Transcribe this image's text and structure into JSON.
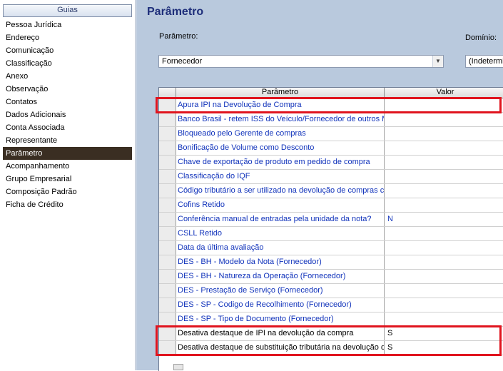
{
  "sidebar": {
    "header": "Guias",
    "items": [
      {
        "label": "Pessoa Jurídica",
        "selected": false
      },
      {
        "label": "Endereço",
        "selected": false
      },
      {
        "label": "Comunicação",
        "selected": false
      },
      {
        "label": "Classificação",
        "selected": false
      },
      {
        "label": "Anexo",
        "selected": false
      },
      {
        "label": "Observação",
        "selected": false
      },
      {
        "label": "Contatos",
        "selected": false
      },
      {
        "label": "Dados Adicionais",
        "selected": false
      },
      {
        "label": "Conta Associada",
        "selected": false
      },
      {
        "label": "Representante",
        "selected": false
      },
      {
        "label": "Parâmetro",
        "selected": true
      },
      {
        "label": "Acompanhamento",
        "selected": false
      },
      {
        "label": "Grupo Empresarial",
        "selected": false
      },
      {
        "label": "Composição Padrão",
        "selected": false
      },
      {
        "label": "Ficha de Crédito",
        "selected": false
      }
    ]
  },
  "main": {
    "title": "Parâmetro",
    "parametro_label": "Parâmetro:",
    "parametro_value": "Fornecedor",
    "dominio_label": "Domínio:",
    "dominio_value": "(Indetermin"
  },
  "grid": {
    "columns": [
      "Parâmetro",
      "Valor"
    ],
    "rows": [
      {
        "param": "Apura IPI na Devolução de Compra",
        "value": "",
        "highlight": true
      },
      {
        "param": "Banco Brasil - retem ISS do Veículo/Fornecedor de outros M",
        "value": ""
      },
      {
        "param": "Bloqueado pelo Gerente de compras",
        "value": ""
      },
      {
        "param": "Bonificação de Volume como Desconto",
        "value": ""
      },
      {
        "param": "Chave de exportação de produto em pedido de compra",
        "value": ""
      },
      {
        "param": "Classificação do IQF",
        "value": ""
      },
      {
        "param": "Código tributário a ser utilizado na devolução de compras co",
        "value": ""
      },
      {
        "param": "Cofins Retido",
        "value": ""
      },
      {
        "param": "Conferência manual de entradas pela unidade da nota?",
        "value": "N"
      },
      {
        "param": "CSLL Retido",
        "value": ""
      },
      {
        "param": "Data da última avaliação",
        "value": ""
      },
      {
        "param": "DES - BH - Modelo da Nota (Fornecedor)",
        "value": ""
      },
      {
        "param": "DES - BH - Natureza da Operação (Fornecedor)",
        "value": ""
      },
      {
        "param": "DES - Prestação de Serviço (Fornecedor)",
        "value": ""
      },
      {
        "param": "DES - SP - Codigo de Recolhimento (Fornecedor)",
        "value": ""
      },
      {
        "param": "DES - SP - Tipo de Documento (Fornecedor)",
        "value": ""
      },
      {
        "param": "Desativa destaque de IPI na devolução da compra",
        "value": "S",
        "dark": true,
        "highlight": true
      },
      {
        "param": "Desativa destaque de substituição tributária na devolução d",
        "value": "S",
        "dark": true,
        "highlight": true
      }
    ]
  },
  "colors": {
    "highlight": "#e0141e",
    "link_text": "#1133bb",
    "main_bg": "#b9c9dd",
    "selected_nav_bg": "#3a2e22"
  }
}
